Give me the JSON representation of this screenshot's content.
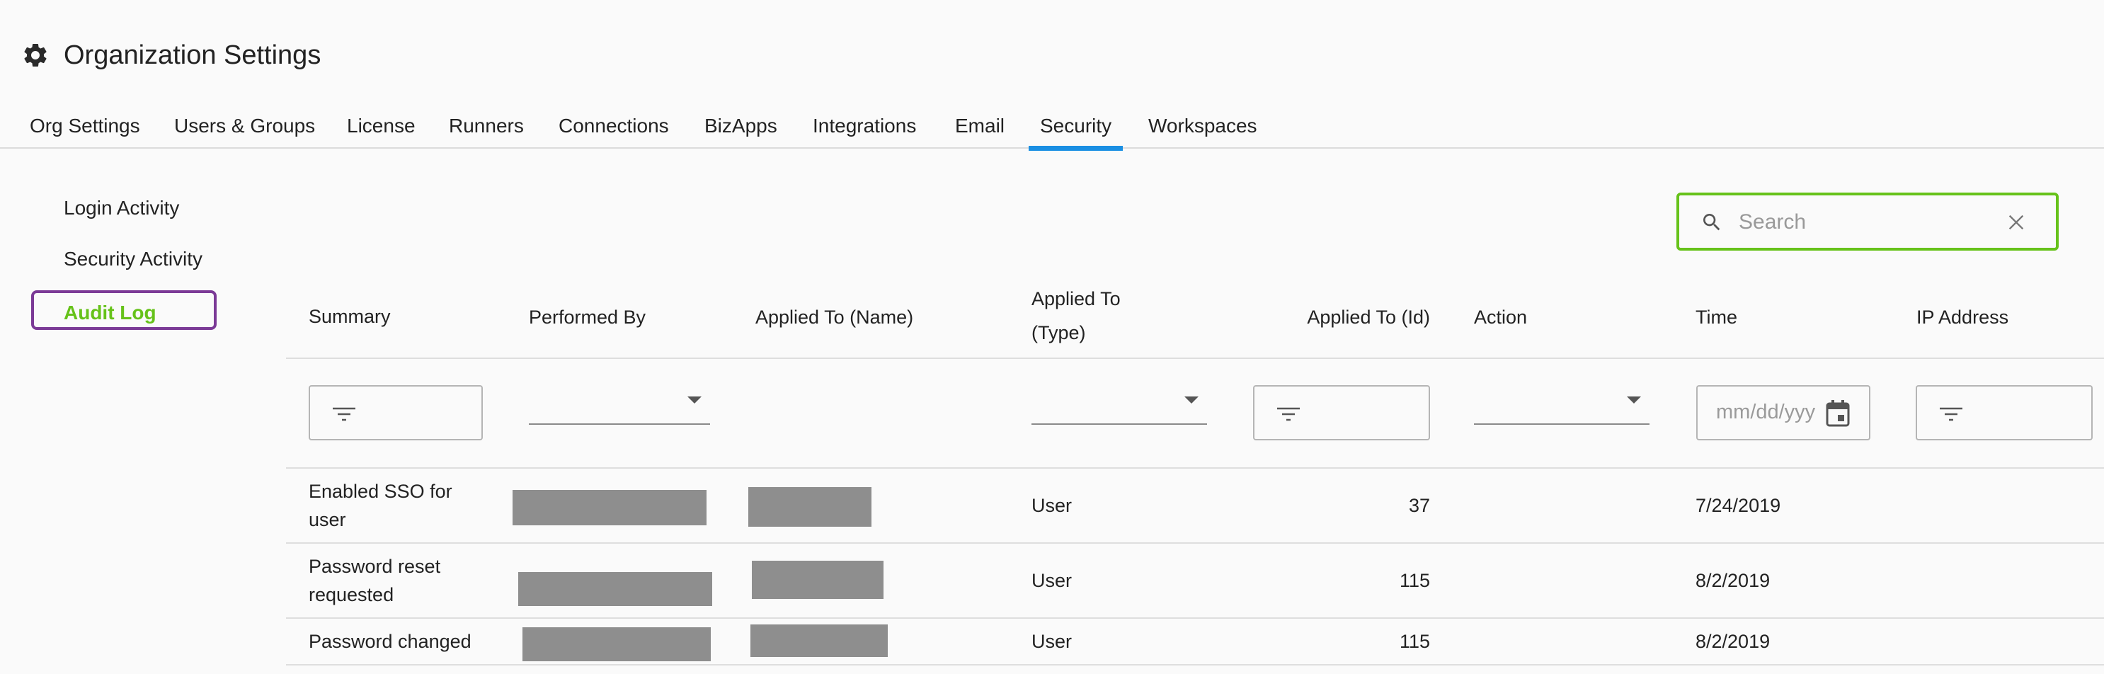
{
  "header": {
    "icon": "gear-icon",
    "title": "Organization Settings"
  },
  "tabs": [
    {
      "label": "Org Settings",
      "active": false
    },
    {
      "label": "Users & Groups",
      "active": false
    },
    {
      "label": "License",
      "active": false
    },
    {
      "label": "Runners",
      "active": false
    },
    {
      "label": "Connections",
      "active": false
    },
    {
      "label": "BizApps",
      "active": false
    },
    {
      "label": "Integrations",
      "active": false
    },
    {
      "label": "Email",
      "active": false
    },
    {
      "label": "Security",
      "active": true
    },
    {
      "label": "Workspaces",
      "active": false
    }
  ],
  "sidebar": {
    "items": [
      {
        "label": "Login Activity",
        "active": false
      },
      {
        "label": "Security Activity",
        "active": false
      },
      {
        "label": "Audit Log",
        "active": true
      }
    ]
  },
  "search": {
    "placeholder": "Search",
    "value": ""
  },
  "table": {
    "columns": [
      {
        "label": "Summary",
        "filter": "text"
      },
      {
        "label": "Performed By",
        "filter": "select"
      },
      {
        "label": "Applied To (Name)",
        "filter": "none"
      },
      {
        "label": "Applied To (Type)",
        "filter": "select"
      },
      {
        "label": "Applied To (Id)",
        "filter": "text"
      },
      {
        "label": "Action",
        "filter": "select"
      },
      {
        "label": "Time",
        "filter": "date"
      },
      {
        "label": "IP Address",
        "filter": "text"
      }
    ],
    "date_placeholder": "mm/dd/yyyy",
    "rows": [
      {
        "summary": "Enabled SSO for user",
        "performed_by": "",
        "applied_to_name": "",
        "applied_to_type": "User",
        "applied_to_id": "37",
        "action": "",
        "time": "7/24/2019",
        "ip_address": ""
      },
      {
        "summary": "Password reset requested",
        "performed_by": "",
        "applied_to_name": "",
        "applied_to_type": "User",
        "applied_to_id": "115",
        "action": "",
        "time": "8/2/2019",
        "ip_address": ""
      },
      {
        "summary": "Password changed",
        "performed_by": "",
        "applied_to_name": "",
        "applied_to_type": "User",
        "applied_to_id": "115",
        "action": "",
        "time": "8/2/2019",
        "ip_address": ""
      }
    ]
  },
  "colors": {
    "tab_active_underline": "#1a8fe3",
    "sidebar_active_text": "#66c21a",
    "sidebar_active_border": "#7b3a96",
    "search_border": "#66c21a",
    "redaction": "#8e8e8e"
  }
}
